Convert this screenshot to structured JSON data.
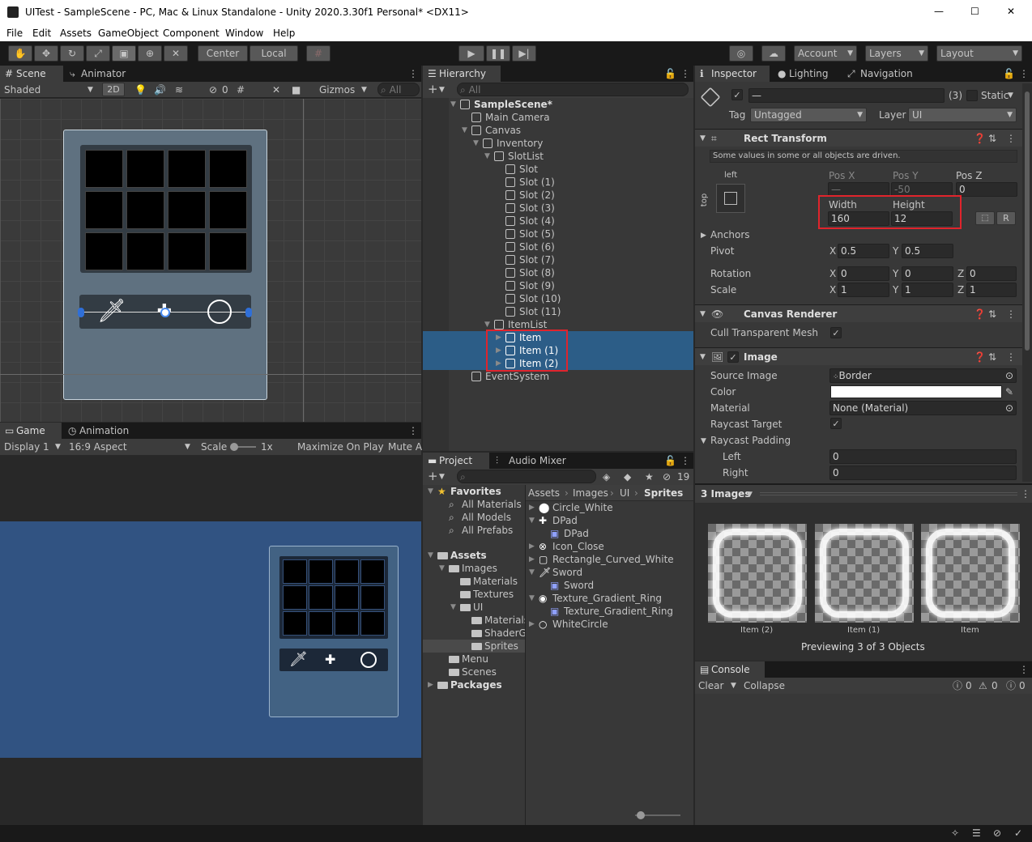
{
  "window": {
    "title": "UITest - SampleScene - PC, Mac & Linux Standalone - Unity 2020.3.30f1 Personal* <DX11>",
    "min": "—",
    "max": "☐",
    "close": "✕"
  },
  "menu": [
    "File",
    "Edit",
    "Assets",
    "GameObject",
    "Component",
    "Window",
    "Help"
  ],
  "toolbar": {
    "center": "Center",
    "local": "Local",
    "account": "Account",
    "layers": "Layers",
    "layout": "Layout"
  },
  "scene": {
    "tab_scene": "Scene",
    "tab_animator": "Animator",
    "shaded": "Shaded",
    "btn2d": "2D",
    "hidden_count": "0",
    "gizmos": "Gizmos",
    "search_placeholder": "All"
  },
  "game": {
    "tab_game": "Game",
    "tab_animation": "Animation",
    "display": "Display 1",
    "aspect": "16:9 Aspect",
    "scale_label": "Scale",
    "scale_value": "1x",
    "maximize": "Maximize On Play",
    "mute": "Mute A"
  },
  "hierarchy": {
    "tab": "Hierarchy",
    "search_placeholder": "All",
    "items": [
      {
        "label": "SampleScene*",
        "indent": 0,
        "bold": true,
        "icon": "unity-scene-icon",
        "arrow": "▼"
      },
      {
        "label": "Main Camera",
        "indent": 1,
        "icon": "gameobject-cube-icon",
        "arrow": ""
      },
      {
        "label": "Canvas",
        "indent": 1,
        "icon": "gameobject-cube-icon",
        "arrow": "▼"
      },
      {
        "label": "Inventory",
        "indent": 2,
        "icon": "gameobject-cube-icon",
        "arrow": "▼"
      },
      {
        "label": "SlotList",
        "indent": 3,
        "icon": "gameobject-cube-icon",
        "arrow": "▼"
      },
      {
        "label": "Slot",
        "indent": 4,
        "icon": "gameobject-cube-icon",
        "arrow": ""
      },
      {
        "label": "Slot (1)",
        "indent": 4,
        "icon": "gameobject-cube-icon",
        "arrow": ""
      },
      {
        "label": "Slot (2)",
        "indent": 4,
        "icon": "gameobject-cube-icon",
        "arrow": ""
      },
      {
        "label": "Slot (3)",
        "indent": 4,
        "icon": "gameobject-cube-icon",
        "arrow": ""
      },
      {
        "label": "Slot (4)",
        "indent": 4,
        "icon": "gameobject-cube-icon",
        "arrow": ""
      },
      {
        "label": "Slot (5)",
        "indent": 4,
        "icon": "gameobject-cube-icon",
        "arrow": ""
      },
      {
        "label": "Slot (6)",
        "indent": 4,
        "icon": "gameobject-cube-icon",
        "arrow": ""
      },
      {
        "label": "Slot (7)",
        "indent": 4,
        "icon": "gameobject-cube-icon",
        "arrow": ""
      },
      {
        "label": "Slot (8)",
        "indent": 4,
        "icon": "gameobject-cube-icon",
        "arrow": ""
      },
      {
        "label": "Slot (9)",
        "indent": 4,
        "icon": "gameobject-cube-icon",
        "arrow": ""
      },
      {
        "label": "Slot (10)",
        "indent": 4,
        "icon": "gameobject-cube-icon",
        "arrow": ""
      },
      {
        "label": "Slot (11)",
        "indent": 4,
        "icon": "gameobject-cube-icon",
        "arrow": ""
      },
      {
        "label": "ItemList",
        "indent": 3,
        "icon": "gameobject-cube-icon",
        "arrow": "▼"
      },
      {
        "label": "Item",
        "indent": 4,
        "icon": "gameobject-cube-icon",
        "arrow": "▶",
        "selected": true
      },
      {
        "label": "Item (1)",
        "indent": 4,
        "icon": "gameobject-cube-icon",
        "arrow": "▶",
        "selected": true
      },
      {
        "label": "Item (2)",
        "indent": 4,
        "icon": "gameobject-cube-icon",
        "arrow": "▶",
        "selected": true
      },
      {
        "label": "EventSystem",
        "indent": 1,
        "icon": "gameobject-cube-icon",
        "arrow": ""
      }
    ]
  },
  "project": {
    "tab_project": "Project",
    "tab_audio": "Audio Mixer",
    "hidden_count": "19",
    "tree": [
      {
        "label": "Favorites",
        "indent": 0,
        "bold": true,
        "arrow": "▼",
        "icon": "star-icon"
      },
      {
        "label": "All Materials",
        "indent": 1,
        "icon": "search-icon"
      },
      {
        "label": "All Models",
        "indent": 1,
        "icon": "search-icon"
      },
      {
        "label": "All Prefabs",
        "indent": 1,
        "icon": "search-icon"
      },
      {
        "label": "Assets",
        "indent": 0,
        "bold": true,
        "arrow": "▼",
        "icon": "folder-icon",
        "gap": true
      },
      {
        "label": "Images",
        "indent": 1,
        "arrow": "▼",
        "icon": "folder-icon"
      },
      {
        "label": "Materials",
        "indent": 2,
        "icon": "folder-icon"
      },
      {
        "label": "Textures",
        "indent": 2,
        "icon": "folder-icon"
      },
      {
        "label": "UI",
        "indent": 2,
        "arrow": "▼",
        "icon": "folder-icon"
      },
      {
        "label": "Materials",
        "indent": 3,
        "icon": "folder-icon"
      },
      {
        "label": "ShaderG",
        "indent": 3,
        "icon": "folder-icon"
      },
      {
        "label": "Sprites",
        "indent": 3,
        "icon": "folder-icon",
        "selected": true
      },
      {
        "label": "Menu",
        "indent": 1,
        "icon": "folder-icon"
      },
      {
        "label": "Scenes",
        "indent": 1,
        "icon": "folder-icon"
      },
      {
        "label": "Packages",
        "indent": 0,
        "bold": true,
        "arrow": "▶",
        "icon": "folder-icon"
      }
    ],
    "breadcrumb": [
      "Assets",
      "Images",
      "UI",
      "Sprites"
    ],
    "assets": [
      {
        "label": "Circle_White",
        "indent": 0,
        "arrow": "▶",
        "icon": "circle-filled-icon"
      },
      {
        "label": "DPad",
        "indent": 0,
        "arrow": "▼",
        "icon": "dpad-icon"
      },
      {
        "label": "DPad",
        "indent": 1,
        "icon": "sprite-icon"
      },
      {
        "label": "Icon_Close",
        "indent": 0,
        "arrow": "▶",
        "icon": "close-circle-icon"
      },
      {
        "label": "Rectangle_Curved_White",
        "indent": 0,
        "arrow": "▶",
        "icon": "rounded-rect-icon"
      },
      {
        "label": "Sword",
        "indent": 0,
        "arrow": "▼",
        "icon": "sword-icon"
      },
      {
        "label": "Sword",
        "indent": 1,
        "icon": "sprite-icon"
      },
      {
        "label": "Texture_Gradient_Ring",
        "indent": 0,
        "arrow": "▼",
        "icon": "ring-icon"
      },
      {
        "label": "Texture_Gradient_Ring",
        "indent": 1,
        "icon": "sprite-icon"
      },
      {
        "label": "WhiteCircle",
        "indent": 0,
        "arrow": "▶",
        "icon": "circle-outline-icon"
      }
    ]
  },
  "inspector": {
    "tab_inspector": "Inspector",
    "tab_lighting": "Lighting",
    "tab_navigation": "Navigation",
    "name_value": "—",
    "count": "(3)",
    "static": "Static",
    "tag_label": "Tag",
    "tag_value": "Untagged",
    "layer_label": "Layer",
    "layer_value": "UI",
    "rect": {
      "title": "Rect Transform",
      "driven": "Some values in some or all objects are driven.",
      "anchor_left": "left",
      "anchor_top": "top",
      "posx_label": "Pos X",
      "posy_label": "Pos Y",
      "posz_label": "Pos Z",
      "posx": "—",
      "posy": "-50",
      "posz": "0",
      "width_label": "Width",
      "height_label": "Height",
      "width": "160",
      "height": "12",
      "r": "R",
      "anchors": "Anchors",
      "pivot": "Pivot",
      "pivot_x": "0.5",
      "pivot_y": "0.5",
      "rotation": "Rotation",
      "scale": "Scale",
      "rot_x": "0",
      "rot_y": "0",
      "rot_z": "0",
      "scale_x": "1",
      "scale_y": "1",
      "scale_z": "1",
      "x": "X",
      "y": "Y",
      "z": "Z"
    },
    "canvas_renderer": {
      "title": "Canvas Renderer",
      "cull": "Cull Transparent Mesh"
    },
    "image": {
      "title": "Image",
      "source_label": "Source Image",
      "source_value": "Border",
      "color_label": "Color",
      "material_label": "Material",
      "material_value": "None (Material)",
      "raycast_target": "Raycast Target",
      "raycast_padding": "Raycast Padding",
      "left": "Left",
      "left_value": "0",
      "right": "Right",
      "right_value": "0"
    },
    "preview": {
      "header": "3 Images",
      "labels": [
        "Item (2)",
        "Item (1)",
        "Item"
      ],
      "caption": "Previewing 3 of 3 Objects"
    }
  },
  "console": {
    "tab": "Console",
    "clear": "Clear",
    "collapse": "Collapse",
    "info": "0",
    "warn": "0",
    "error": "0"
  },
  "colors": {
    "selection": "#2c5d87",
    "highlight_box": "#e0242c",
    "game_bg": "#315382"
  }
}
